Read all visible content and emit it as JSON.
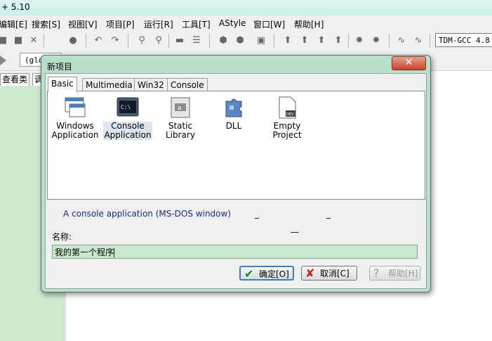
{
  "app": {
    "title_fragment": "+ 5.10"
  },
  "menu": [
    "编辑[E]",
    "搜索[S]",
    "视图[V]",
    "项目[P]",
    "运行[R]",
    "工具[T]",
    "AStyle",
    "窗口[W]",
    "帮助[H]"
  ],
  "toolbar": {
    "compiler": "TDM-GCC 4.8"
  },
  "scope_combo": "(glo",
  "side_tabs": [
    "查看类",
    "调"
  ],
  "dialog": {
    "title": "新项目",
    "close_glyph": "✕",
    "tabs": [
      "Basic",
      "Multimedia",
      "Win32",
      "Console"
    ],
    "active_tab": "Basic",
    "templates": [
      {
        "label_line1": "Windows",
        "label_line2": "Application",
        "icon": "windows-app-icon"
      },
      {
        "label_line1": "Console",
        "label_line2": "Application",
        "icon": "console-app-icon",
        "selected": true
      },
      {
        "label_line1": "Static Library",
        "label_line2": "",
        "icon": "static-library-icon"
      },
      {
        "label_line1": "DLL",
        "label_line2": "",
        "icon": "dll-icon"
      },
      {
        "label_line1": "Empty Project",
        "label_line2": "",
        "icon": "empty-project-icon"
      }
    ],
    "description": "A console application (MS-DOS window)",
    "name_label": "名称:",
    "name_value": "我的第一个程序",
    "ok_label": "确定[O]",
    "cancel_label": "取消[C]",
    "help_label": "帮助[H]"
  },
  "colors": {
    "dialog_bg": "#b9dfca",
    "input_bg": "#c9e8cf",
    "side_panel": "#cfe9cf",
    "close_red": "#c7452d"
  }
}
